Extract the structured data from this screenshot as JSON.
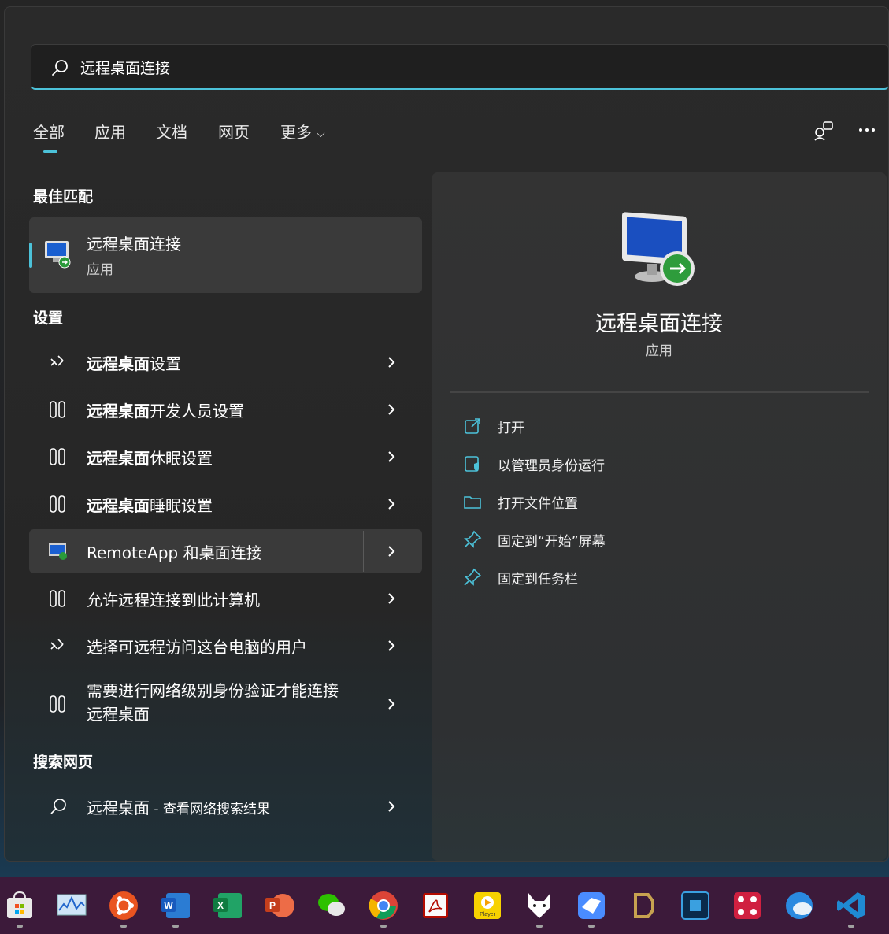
{
  "search": {
    "value": "远程桌面连接"
  },
  "tabs": [
    {
      "label": "全部"
    },
    {
      "label": "应用"
    },
    {
      "label": "文档"
    },
    {
      "label": "网页"
    },
    {
      "label": "更多"
    }
  ],
  "sections": {
    "best_match": "最佳匹配",
    "settings": "设置",
    "web": "搜索网页"
  },
  "best_match": {
    "title": "远程桌面连接",
    "subtitle": "应用"
  },
  "settings_items": [
    {
      "bold": "远程桌面",
      "rest": "设置",
      "icon": "remote-desktop-icon"
    },
    {
      "bold": "远程桌面",
      "rest": "开发人员设置",
      "icon": "developer-tools-icon"
    },
    {
      "bold": "远程桌面",
      "rest": "休眠设置",
      "icon": "developer-tools-icon"
    },
    {
      "bold": "远程桌面",
      "rest": "睡眠设置",
      "icon": "developer-tools-icon"
    },
    {
      "bold": "",
      "rest": "RemoteApp 和桌面连接",
      "icon": "remoteapp-icon"
    },
    {
      "bold": "",
      "rest": "允许远程连接到此计算机",
      "icon": "developer-tools-icon"
    },
    {
      "bold": "",
      "rest": "选择可远程访问这台电脑的用户",
      "icon": "remote-desktop-icon"
    },
    {
      "bold": "",
      "rest": "需要进行网络级别身份验证才能连接远程桌面",
      "icon": "developer-tools-icon"
    }
  ],
  "web_item": {
    "query": "远程桌面",
    "suffix": " - 查看网络搜索结果"
  },
  "detail": {
    "title": "远程桌面连接",
    "subtitle": "应用",
    "actions": [
      {
        "label": "打开",
        "icon": "open-external-icon"
      },
      {
        "label": "以管理员身份运行",
        "icon": "run-as-admin-icon"
      },
      {
        "label": "打开文件位置",
        "icon": "folder-icon"
      },
      {
        "label": "固定到“开始”屏幕",
        "icon": "pin-icon"
      },
      {
        "label": "固定到任务栏",
        "icon": "pin-icon"
      }
    ]
  },
  "taskbar": [
    {
      "name": "microsoft-store-icon"
    },
    {
      "name": "resource-monitor-icon"
    },
    {
      "name": "ubuntu-icon"
    },
    {
      "name": "word-icon"
    },
    {
      "name": "excel-icon"
    },
    {
      "name": "powerpoint-icon"
    },
    {
      "name": "wechat-icon"
    },
    {
      "name": "chrome-icon"
    },
    {
      "name": "acrobat-icon"
    },
    {
      "name": "potplayer-icon"
    },
    {
      "name": "foobar-fox-icon"
    },
    {
      "name": "feishu-bird-icon"
    },
    {
      "name": "app-d-icon"
    },
    {
      "name": "chip-icon"
    },
    {
      "name": "dots-app-icon"
    },
    {
      "name": "globe-app-icon"
    },
    {
      "name": "vscode-icon"
    }
  ],
  "colors": {
    "accent": "#4cc2d9",
    "panel": "#2a2a2a",
    "taskbar": "#3c1a3a"
  }
}
